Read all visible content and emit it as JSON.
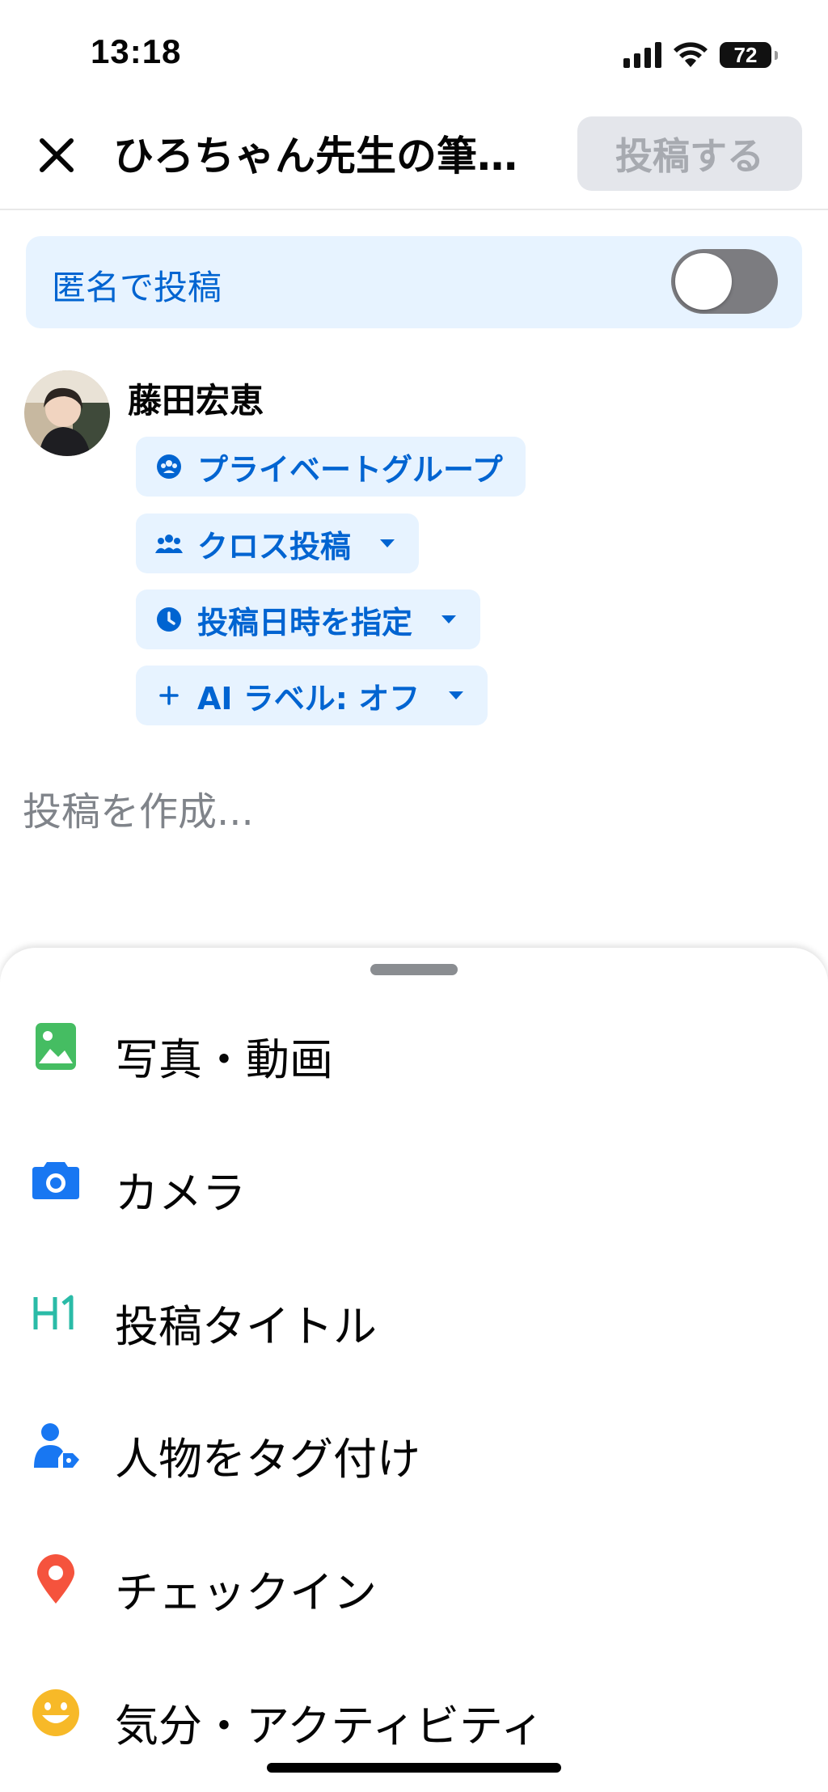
{
  "status_bar": {
    "time": "13:18",
    "battery": "72"
  },
  "header": {
    "title": "ひろちゃん先生の筆…",
    "post_button": "投稿する"
  },
  "anonymous": {
    "label": "匿名で投稿",
    "enabled": false
  },
  "user": {
    "name": "藤田宏恵"
  },
  "chips": [
    {
      "label": "プライベートグループ",
      "icon": "group-icon"
    },
    {
      "label": "クロス投稿",
      "icon": "people-icon"
    },
    {
      "label": "投稿日時を指定",
      "icon": "clock-icon"
    },
    {
      "label": "AI ラベル: オフ",
      "icon": "plus-icon"
    }
  ],
  "composer": {
    "placeholder": "投稿を作成..."
  },
  "menu": [
    {
      "label": "写真・動画",
      "icon": "photo-icon"
    },
    {
      "label": "カメラ",
      "icon": "camera-icon"
    },
    {
      "label": "投稿タイトル",
      "icon": "h1-icon"
    },
    {
      "label": "人物をタグ付け",
      "icon": "tag-person-icon"
    },
    {
      "label": "チェックイン",
      "icon": "location-pin-icon"
    },
    {
      "label": "気分・アクティビティ",
      "icon": "smiley-icon"
    }
  ],
  "colors": {
    "accent": "#0064d1",
    "chip_bg": "#e7f3ff",
    "photo_green": "#45bd62",
    "camera_blue": "#1877f2",
    "title_teal": "#2abba7",
    "pin_red": "#f5533d",
    "smiley_yellow": "#f7b928"
  }
}
